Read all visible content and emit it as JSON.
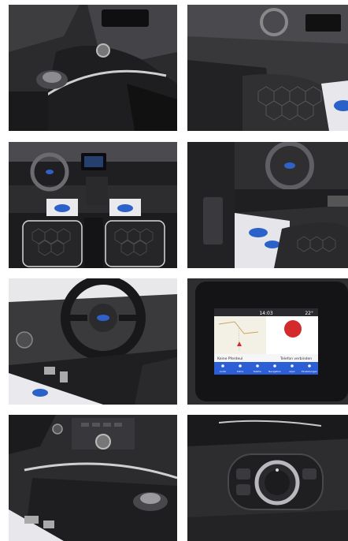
{
  "gallery": {
    "photos": [
      {
        "subject": "center-console"
      },
      {
        "subject": "front-seat-console"
      },
      {
        "subject": "dashboard-overview"
      },
      {
        "subject": "driver-door-seat"
      },
      {
        "subject": "steering-wheel-pedals"
      },
      {
        "subject": "infotainment-screen"
      },
      {
        "subject": "console-rotary-knob"
      },
      {
        "subject": "light-switch"
      }
    ]
  },
  "screen": {
    "clock": "14:03",
    "temp": "22°",
    "status_left": "Keine Pferdeul",
    "status_right": "Telefon verbinden",
    "nav_items": [
      "Audio",
      "Klima",
      "Telefon",
      "Navigation",
      "Apps",
      "Einstellungen"
    ]
  },
  "colors": {
    "leather": "#2a2a2c",
    "trim": "#c9c9c9",
    "screen_accent": "#2c5fd6",
    "badge_red": "#d32b2b",
    "mat_blue": "#2a62c9"
  }
}
